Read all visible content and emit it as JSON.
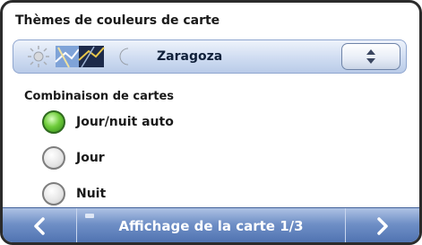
{
  "screen": {
    "section_title": "Thèmes de couleurs de carte",
    "theme_selector": {
      "selected_value": "Zaragoza",
      "icons": [
        "sun-icon",
        "day-map-thumbnail",
        "night-map-thumbnail",
        "moon-icon"
      ]
    },
    "combination": {
      "title": "Combinaison de cartes",
      "options": [
        {
          "label": "Jour/nuit auto",
          "checked": true
        },
        {
          "label": "Jour",
          "checked": false
        },
        {
          "label": "Nuit",
          "checked": false
        }
      ]
    },
    "nav": {
      "prev_icon": "chevron-left-icon",
      "title": "Affichage de la carte 1/3",
      "next_icon": "chevron-right-icon"
    }
  },
  "colors": {
    "accent_green": "#6fcc3b",
    "nav_blue": "#4f72b0"
  }
}
